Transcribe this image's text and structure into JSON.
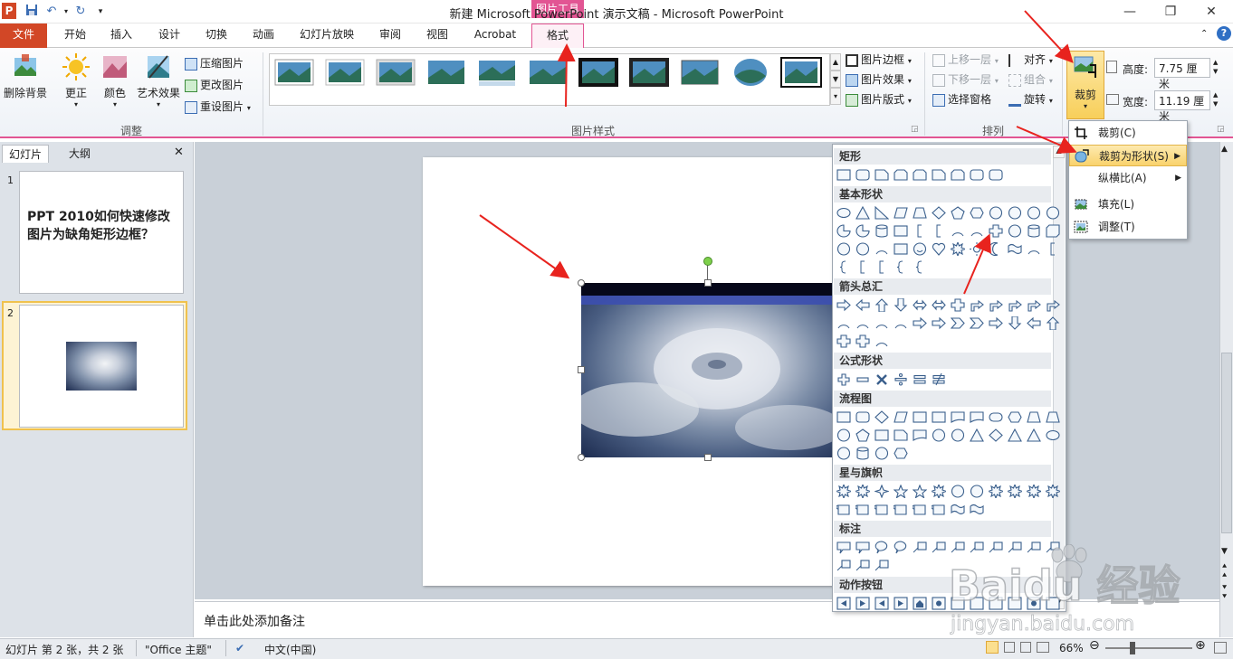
{
  "window": {
    "title": "新建 Microsoft PowerPoint 演示文稿 - Microsoft PowerPoint",
    "app_icon": "P",
    "context_tool_title": "图片工具"
  },
  "tabs": [
    "文件",
    "开始",
    "插入",
    "设计",
    "切换",
    "动画",
    "幻灯片放映",
    "审阅",
    "视图",
    "Acrobat",
    "格式"
  ],
  "ribbon": {
    "adjust": {
      "remove_bg": "删除背景",
      "corrections": "更正",
      "color": "颜色",
      "artistic": "艺术效果",
      "compress": "压缩图片",
      "change": "更改图片",
      "reset": "重设图片",
      "label": "调整"
    },
    "styles": {
      "border": "图片边框",
      "effects": "图片效果",
      "layout": "图片版式",
      "label": "图片样式"
    },
    "arrange": {
      "bring_forward": "上移一层",
      "send_backward": "下移一层",
      "selection_pane": "选择窗格",
      "align": "对齐",
      "group": "组合",
      "rotate": "旋转",
      "label": "排列"
    },
    "size": {
      "crop": "裁剪",
      "height_label": "高度:",
      "height_value": "7.75 厘米",
      "width_label": "宽度:",
      "width_value": "11.19 厘米"
    }
  },
  "left_pane": {
    "tab_slides": "幻灯片",
    "tab_outline": "大纲",
    "close": "✕",
    "slide1_num": "1",
    "slide1_title": "PPT 2010如何快速修改图片为缺角矩形边框？",
    "slide2_num": "2"
  },
  "notes_placeholder": "单击此处添加备注",
  "crop_menu": {
    "items": [
      {
        "label": "裁剪(C)"
      },
      {
        "label": "裁剪为形状(S)"
      },
      {
        "label": "纵横比(A)"
      },
      {
        "label": "填充(L)"
      },
      {
        "label": "调整(T)"
      }
    ]
  },
  "shapes_gallery": {
    "categories": [
      "矩形",
      "基本形状",
      "箭头总汇",
      "公式形状",
      "流程图",
      "星与旗帜",
      "标注",
      "动作按钮"
    ]
  },
  "status_bar": {
    "slide_info": "幻灯片 第 2 张，共 2 张",
    "theme": "\"Office 主题\"",
    "language": "中文(中国)",
    "zoom": "66%"
  },
  "watermark": {
    "brand": "Baidu 经验",
    "url": "jingyan.baidu.com"
  },
  "colors": {
    "file_tab": "#d24726",
    "context_accent": "#e25593",
    "highlight": "#f9d26c",
    "annotation_arrow": "#e8231e"
  }
}
